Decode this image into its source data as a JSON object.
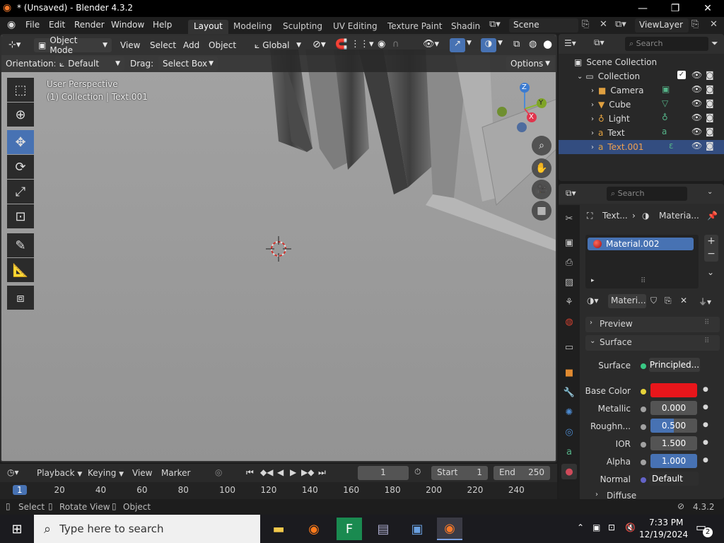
{
  "window": {
    "title": "* (Unsaved) - Blender 4.3.2"
  },
  "menu": {
    "file": "File",
    "edit": "Edit",
    "render": "Render",
    "window": "Window",
    "help": "Help"
  },
  "workspaces": [
    "Layout",
    "Modeling",
    "Sculpting",
    "UV Editing",
    "Texture Paint",
    "Shading"
  ],
  "scene": {
    "name": "Scene",
    "view_layer": "ViewLayer"
  },
  "viewport": {
    "mode": "Object Mode",
    "view": "View",
    "select": "Select",
    "add": "Add",
    "object": "Object",
    "transform": "Global",
    "orientation_label": "Orientation:",
    "orientation": "Default",
    "drag_label": "Drag:",
    "drag": "Select Box",
    "options": "Options",
    "overlay_line1": "User Perspective",
    "overlay_line2": "(1) Collection | Text.001",
    "axis_z": "Z",
    "axis_y": "Y",
    "axis_x": "X"
  },
  "outliner": {
    "search_placeholder": "Search",
    "scene_collection": "Scene Collection",
    "collection": "Collection",
    "items": [
      {
        "name": "Camera",
        "icon": "camera-icon"
      },
      {
        "name": "Cube",
        "icon": "mesh-icon"
      },
      {
        "name": "Light",
        "icon": "light-icon"
      },
      {
        "name": "Text",
        "icon": "text-icon"
      },
      {
        "name": "Text.001",
        "icon": "text-icon"
      }
    ]
  },
  "properties": {
    "search_placeholder": "Search",
    "breadcrumb_object": "Text...",
    "breadcrumb_material": "Materia...",
    "material_slot": "Material.002",
    "material_name": "Materi...",
    "preview": "Preview",
    "surface_panel": "Surface",
    "surface_label": "Surface",
    "surface_value": "Principled...",
    "base_color_label": "Base Color",
    "base_color": "#e8161b",
    "metallic_label": "Metallic",
    "metallic": "0.000",
    "roughness_label": "Roughn...",
    "roughness": "0.500",
    "ior_label": "IOR",
    "ior": "1.500",
    "alpha_label": "Alpha",
    "alpha": "1.000",
    "normal_label": "Normal",
    "normal": "Default",
    "diffuse": "Diffuse"
  },
  "timeline": {
    "playback": "Playback",
    "keying": "Keying",
    "view": "View",
    "marker": "Marker",
    "current_frame": "1",
    "start_label": "Start",
    "start": "1",
    "end_label": "End",
    "end": "250",
    "ticks": [
      "1",
      "20",
      "40",
      "60",
      "80",
      "100",
      "120",
      "140",
      "160",
      "180",
      "200",
      "220",
      "240"
    ]
  },
  "status": {
    "select": "Select",
    "rotate": "Rotate View",
    "object": "Object",
    "version": "4.3.2"
  },
  "taskbar": {
    "search_placeholder": "Type here to search",
    "time": "7:33 PM",
    "date": "12/19/2024",
    "notifications": "2"
  },
  "colors": {
    "accent": "#4772b3",
    "selected_row": "#334d80"
  }
}
